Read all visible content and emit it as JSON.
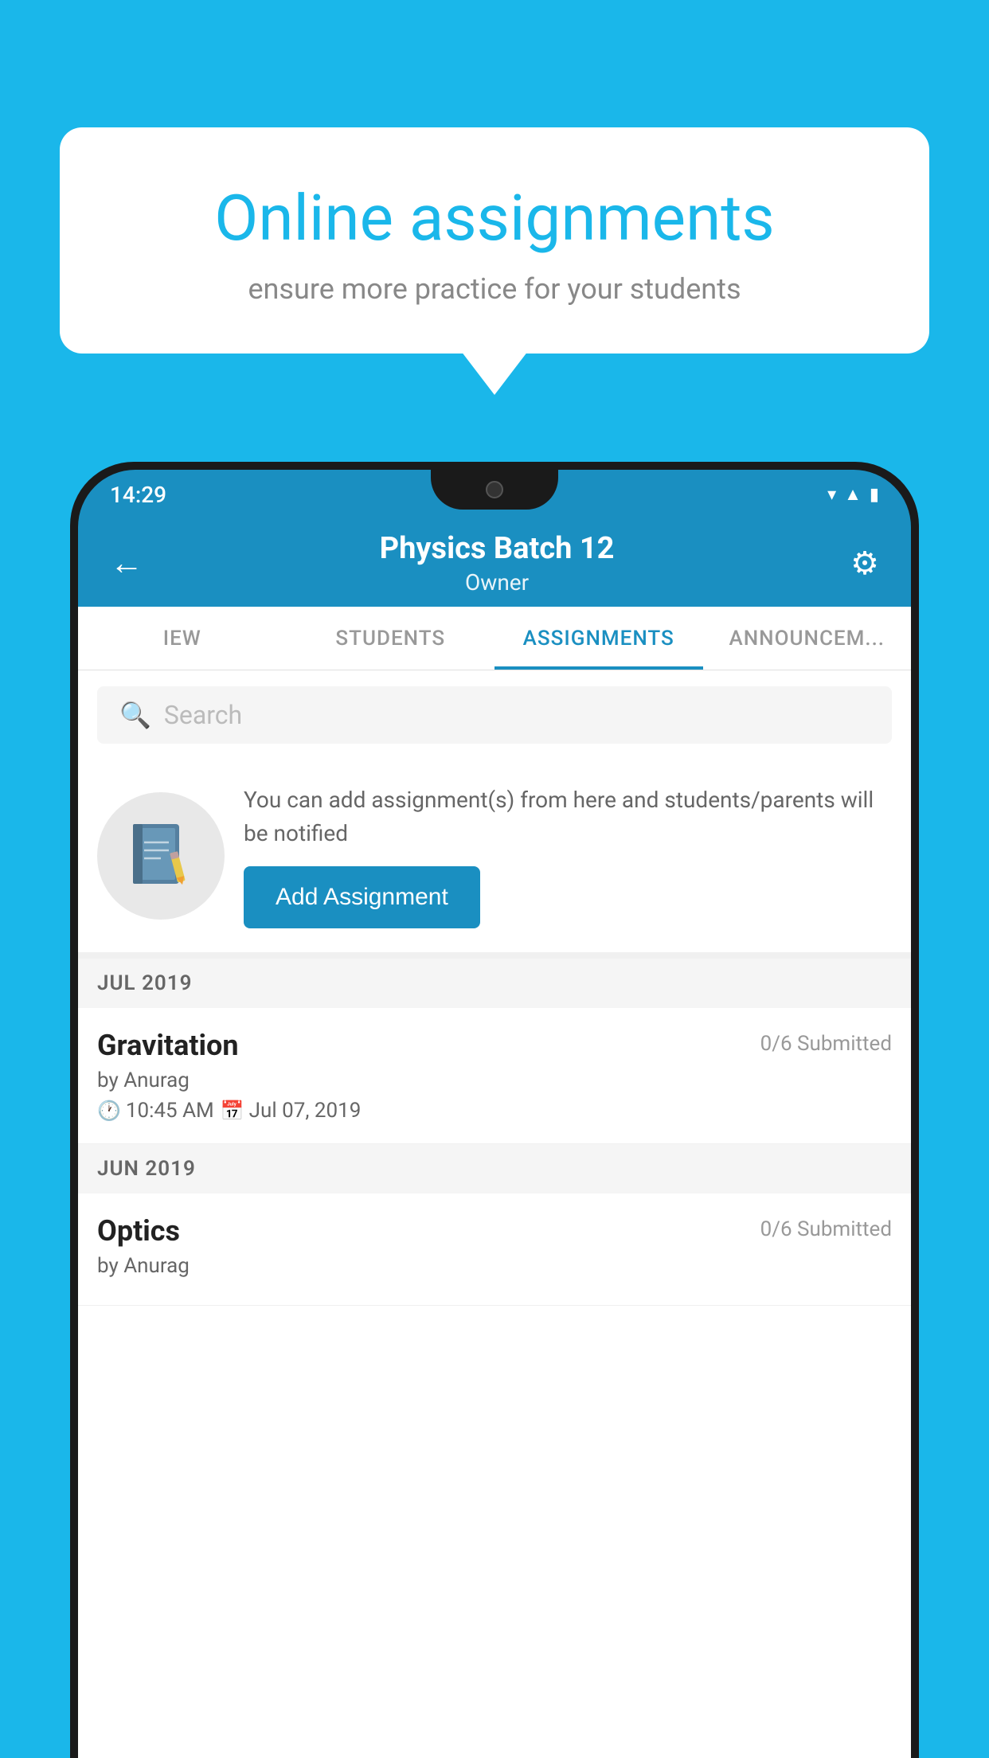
{
  "background": {
    "color": "#1ab7ea"
  },
  "speech_bubble": {
    "title": "Online assignments",
    "subtitle": "ensure more practice for your students"
  },
  "status_bar": {
    "time": "14:29",
    "icons": [
      "wifi",
      "signal",
      "battery"
    ]
  },
  "app_bar": {
    "title": "Physics Batch 12",
    "subtitle": "Owner",
    "back_label": "←",
    "settings_label": "⚙"
  },
  "tabs": [
    {
      "label": "IEW",
      "active": false
    },
    {
      "label": "STUDENTS",
      "active": false
    },
    {
      "label": "ASSIGNMENTS",
      "active": true
    },
    {
      "label": "ANNOUNCEM...",
      "active": false
    }
  ],
  "search": {
    "placeholder": "Search"
  },
  "promo": {
    "description": "You can add assignment(s) from here and students/parents will be notified",
    "button_label": "Add Assignment"
  },
  "assignments": {
    "sections": [
      {
        "month": "JUL 2019",
        "items": [
          {
            "name": "Gravitation",
            "submitted": "0/6 Submitted",
            "by": "by Anurag",
            "time": "10:45 AM",
            "date": "Jul 07, 2019"
          }
        ]
      },
      {
        "month": "JUN 2019",
        "items": [
          {
            "name": "Optics",
            "submitted": "0/6 Submitted",
            "by": "by Anurag",
            "time": "",
            "date": ""
          }
        ]
      }
    ]
  }
}
